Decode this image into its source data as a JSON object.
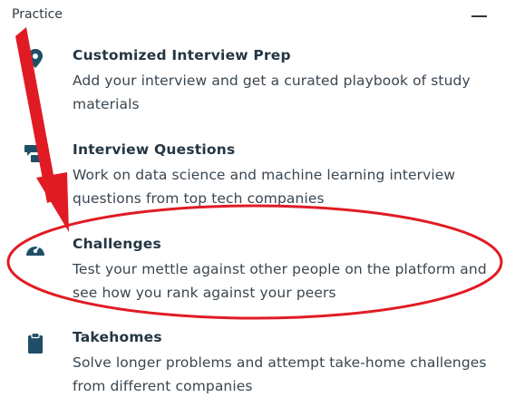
{
  "section": {
    "title": "Practice",
    "toggle_icon": "minus-icon"
  },
  "items": [
    {
      "title": "Customized Interview Prep",
      "description": "Add your interview and get a curated playbook of study materials",
      "icon": "location-pin-icon"
    },
    {
      "title": "Interview Questions",
      "description": "Work on data science and machine learning interview questions from top tech companies",
      "icon": "chat-bubbles-icon"
    },
    {
      "title": "Challenges",
      "description": "Test your mettle against other people on the platform and see how you rank against your peers",
      "icon": "speedometer-icon"
    },
    {
      "title": "Takehomes",
      "description": "Solve longer problems and attempt take-home challenges from different companies",
      "icon": "clipboard-icon"
    }
  ],
  "colors": {
    "icon": "#1f4e66",
    "annotation": "#e11b24",
    "text": "#2c3a45"
  }
}
